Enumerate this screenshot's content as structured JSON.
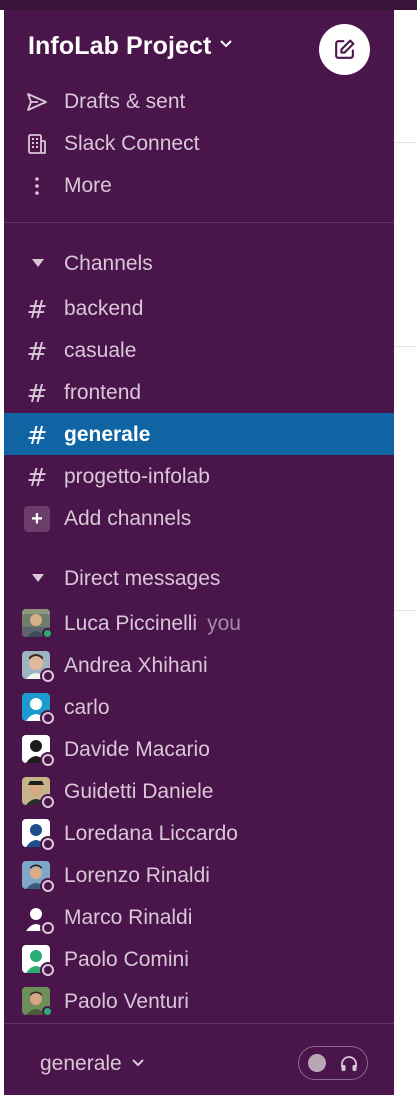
{
  "workspace": {
    "name": "InfoLab Project"
  },
  "top_items": [
    {
      "label": "Drafts & sent",
      "icon": "send-icon"
    },
    {
      "label": "Slack Connect",
      "icon": "building-icon"
    },
    {
      "label": "More",
      "icon": "more-vertical-icon"
    }
  ],
  "channels": {
    "header": "Channels",
    "items": [
      {
        "name": "backend"
      },
      {
        "name": "casuale"
      },
      {
        "name": "frontend"
      },
      {
        "name": "generale",
        "active": true
      },
      {
        "name": "progetto-infolab"
      }
    ],
    "add_label": "Add channels",
    "hash_symbol": "#"
  },
  "direct_messages": {
    "header": "Direct messages",
    "self_suffix": "you",
    "items": [
      {
        "name": "Luca Piccinelli",
        "self": true,
        "status": "online",
        "avatar": "photo"
      },
      {
        "name": "Andrea Xhihani",
        "status": "away",
        "avatar": "photo"
      },
      {
        "name": "carlo",
        "status": "away",
        "avatar": "default-blue"
      },
      {
        "name": "Davide Macario",
        "status": "away",
        "avatar": "default-black"
      },
      {
        "name": "Guidetti Daniele",
        "status": "away",
        "avatar": "photo"
      },
      {
        "name": "Loredana Liccardo",
        "status": "away",
        "avatar": "default-navy"
      },
      {
        "name": "Lorenzo Rinaldi",
        "status": "away",
        "avatar": "photo"
      },
      {
        "name": "Marco Rinaldi",
        "status": "away",
        "avatar": "default-purple"
      },
      {
        "name": "Paolo Comini",
        "status": "away",
        "avatar": "default-green"
      },
      {
        "name": "Paolo Venturi",
        "status": "online",
        "avatar": "photo"
      }
    ]
  },
  "footer": {
    "channel_name": "generale"
  },
  "colors": {
    "sidebar_bg": "#4a154b",
    "active_bg": "#1164a3",
    "text": "#d9c7d8",
    "online": "#2bac76"
  }
}
